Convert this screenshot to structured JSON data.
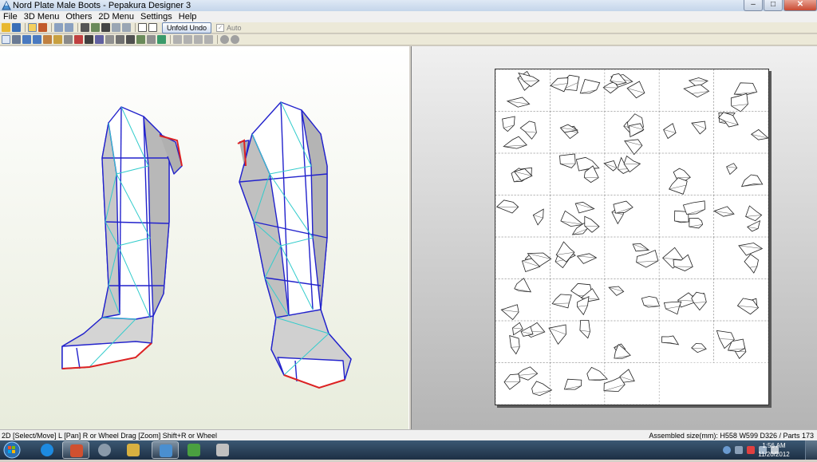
{
  "window": {
    "title": "Nord Plate Male Boots - Pepakura Designer 3",
    "minimize": "–",
    "maximize": "□",
    "close": "✕"
  },
  "menu": [
    "File",
    "3D Menu",
    "Others",
    "2D Menu",
    "Settings",
    "Help"
  ],
  "toolbar": {
    "unfold_undo_label": "Unfold Undo",
    "auto_label": "Auto",
    "auto_checked": true
  },
  "status": {
    "hint": "2D [Select/Move] L [Pan] R or Wheel Drag [Zoom] Shift+R or Wheel",
    "assembled": "Assembled size(mm): H558 W599 D326 / Parts 173"
  },
  "clock": {
    "time": "1:56 AM",
    "date": "11/20/2012"
  },
  "colors": {
    "mesh_edge": "#2222cc",
    "fold_line": "#33cccc",
    "cut_edge": "#dd2222",
    "face": "#ffffff",
    "shadow": "#b4b4b4"
  },
  "icons": {
    "taskbar": [
      "start-orb-icon",
      "ie-icon",
      "3d-app-icon",
      "tool-icon",
      "explorer-icon",
      "pepakura-icon",
      "leaf-icon",
      "camera-icon"
    ]
  }
}
